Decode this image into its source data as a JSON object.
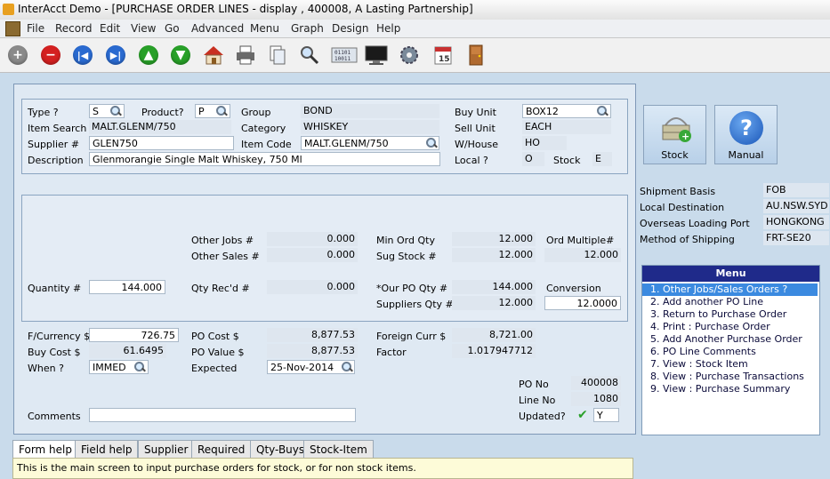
{
  "window": {
    "title": "InterAcct Demo - [PURCHASE ORDER LINES - display , 400008, A Lasting Partnership]"
  },
  "menubar": [
    "File",
    "Record",
    "Edit",
    "View",
    "Go",
    "Advanced",
    "Menu",
    "Graph",
    "Design",
    "Help"
  ],
  "toolbar": [
    "add-icon",
    "delete-icon",
    "first-record-icon",
    "last-record-icon",
    "previous-icon",
    "next-icon",
    "home-icon",
    "print-icon",
    "copy-icon",
    "search-icon",
    "data-icon",
    "screen-icon",
    "settings-icon",
    "calendar-icon",
    "exit-door-icon"
  ],
  "calendar_day": "15",
  "product": {
    "type_label": "Type ?",
    "type_value": "S",
    "product_label": "Product?",
    "product_value": "P",
    "item_search_label": "Item Search",
    "item_search_value": "MALT.GLENM/750",
    "supplier_label": "Supplier #",
    "supplier_value": "GLEN750",
    "description_label": "Description",
    "description_value": "Glenmorangie Single Malt Whiskey, 750 Ml",
    "group_label": "Group",
    "group_value": "BOND",
    "category_label": "Category",
    "category_value": "WHISKEY",
    "item_code_label": "Item Code",
    "item_code_value": "MALT.GLENM/750",
    "buy_unit_label": "Buy Unit",
    "buy_unit_value": "BOX12",
    "sell_unit_label": "Sell Unit",
    "sell_unit_value": "EACH",
    "warehouse_label": "W/House",
    "warehouse_value": "HO",
    "local_label": "Local ?",
    "local_value": "O",
    "stock_label": "Stock",
    "stock_value": "E"
  },
  "qty": {
    "other_jobs_label": "Other Jobs #",
    "other_jobs_value": "0.000",
    "other_sales_label": "Other Sales #",
    "other_sales_value": "0.000",
    "min_ord_label": "Min Ord Qty",
    "min_ord_value": "12.000",
    "ord_multiple_label": "Ord Multiple#",
    "ord_multiple_value": "12.000",
    "sug_stock_label": "Sug Stock #",
    "sug_stock_value": "12.000",
    "quantity_label": "Quantity #",
    "quantity_value": "144.000",
    "qty_recd_label": "Qty Rec'd #",
    "qty_recd_value": "0.000",
    "our_po_label": "*Our PO Qty #",
    "our_po_value": "144.000",
    "conversion_label": "Conversion",
    "suppliers_qty_label": "Suppliers Qty #",
    "suppliers_qty_value": "12.000",
    "conversion_value": "12.0000"
  },
  "cost": {
    "currency_label": "F/Currency $",
    "currency_value": "726.75",
    "buy_cost_label": "Buy Cost $",
    "buy_cost_value": "61.6495",
    "when_label": "When ?",
    "when_value": "IMMED",
    "po_cost_label": "PO Cost $",
    "po_cost_value": "8,877.53",
    "po_value_label": "PO Value $",
    "po_value_value": "8,877.53",
    "expected_label": "Expected",
    "expected_value": "25-Nov-2014",
    "foreign_curr_label": "Foreign Curr $",
    "foreign_curr_value": "8,721.00",
    "factor_label": "Factor",
    "factor_value": "1.017947712",
    "po_no_label": "PO No",
    "po_no_value": "400008",
    "line_no_label": "Line No",
    "line_no_value": "1080",
    "updated_label": "Updated?",
    "updated_value": "Y",
    "comments_label": "Comments",
    "comments_value": ""
  },
  "buttons": {
    "stock": "Stock",
    "manual": "Manual",
    "manual_glyph": "?"
  },
  "shipment": {
    "basis_label": "Shipment Basis",
    "basis_value": "FOB",
    "local_dest_label": "Local Destination",
    "local_dest_value": "AU.NSW.SYD",
    "overseas_label": "Overseas Loading Port",
    "overseas_value": "HONGKONG",
    "method_label": "Method of Shipping",
    "method_value": "FRT-SE20"
  },
  "menu": {
    "title": "Menu",
    "items": [
      "1. Other Jobs/Sales Orders ?",
      "2. Add another PO Line",
      "3. Return to Purchase Order",
      "4. Print : Purchase Order",
      "5. Add Another Purchase Order",
      "6. PO Line Comments",
      "7. View : Stock Item",
      "8. View : Purchase Transactions",
      "9. View : Purchase Summary"
    ]
  },
  "tabs": [
    "Form help",
    "Field help",
    "Supplier",
    "Required",
    "Qty-Buys",
    "Stock-Item"
  ],
  "help_text": "This is the main screen to input purchase orders for stock, or for non stock items.",
  "colors": {
    "menu_header": "#1f2a8a",
    "menu_selected": "#3b8ae0",
    "help_bg": "#fdfbd8",
    "form_bg": "#c9dbeb"
  }
}
